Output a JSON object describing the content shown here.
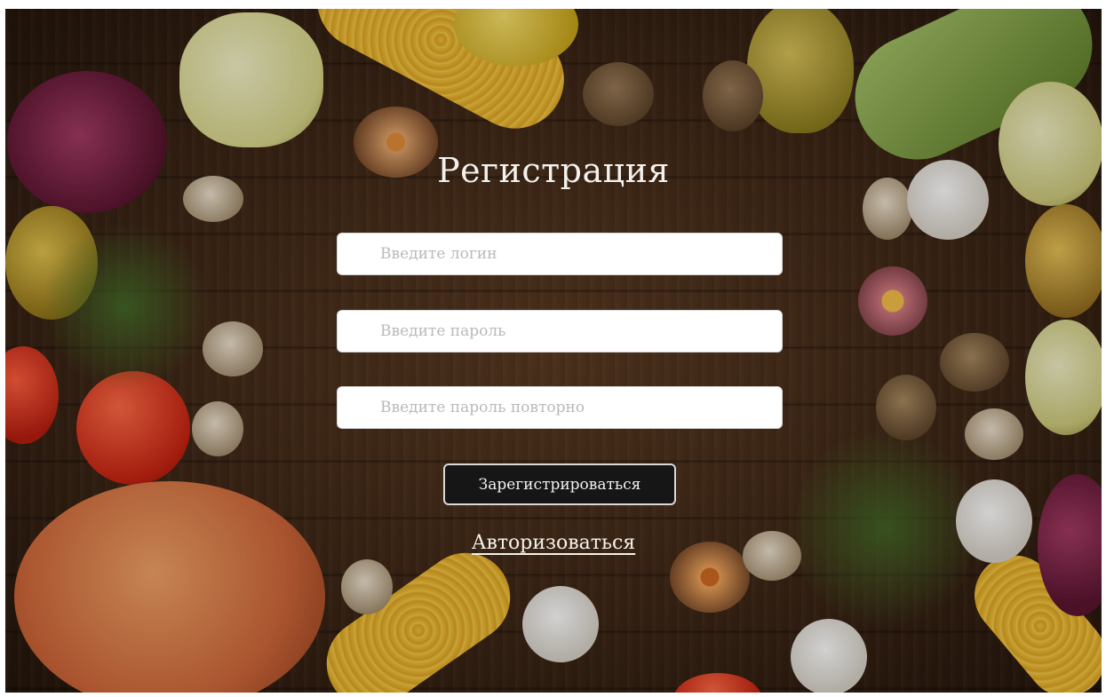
{
  "page": {
    "title": "Регистрация"
  },
  "form": {
    "login_placeholder": "Введите логин",
    "password_placeholder": "Введите пароль",
    "password_repeat_placeholder": "Введите пароль повторно",
    "submit_label": "Зарегистрироваться",
    "login_link_label": "Авторизоваться"
  },
  "colors": {
    "button_bg": "#161616",
    "text_light": "#f4f1ec",
    "background_wood": "#3e2716"
  }
}
